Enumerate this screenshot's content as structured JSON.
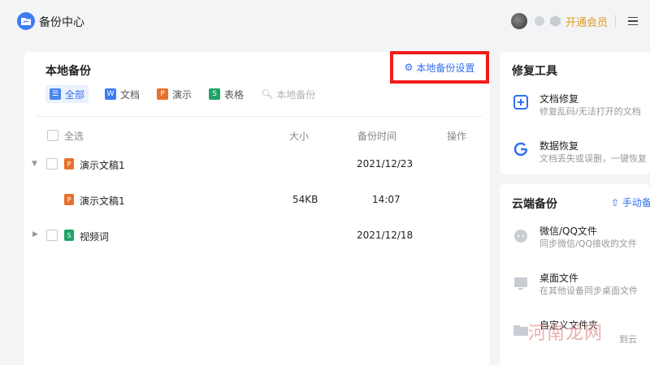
{
  "app": {
    "title": "备份中心"
  },
  "header": {
    "vip_label": "开通会员",
    "icons": [
      "logo-icon",
      "avatar",
      "member-badge-icon",
      "shield-badge-icon",
      "menu-icon"
    ]
  },
  "local_backup": {
    "title": "本地备份",
    "settings_label": "本地备份设置",
    "tabs": [
      {
        "label": "全部",
        "icon": "list-icon",
        "icon_text": "☰",
        "color": "#4a86f0",
        "active": true
      },
      {
        "label": "文档",
        "icon": "word-icon",
        "icon_text": "W",
        "color": "#3d7cf5",
        "active": false
      },
      {
        "label": "演示",
        "icon": "ppt-icon",
        "icon_text": "P",
        "color": "#e8702a",
        "active": false
      },
      {
        "label": "表格",
        "icon": "sheet-icon",
        "icon_text": "S",
        "color": "#21a366",
        "active": false
      }
    ],
    "search_label": "本地备份",
    "columns": {
      "select_all": "全选",
      "size": "大小",
      "time": "备份时间",
      "action": "操作"
    },
    "rows": [
      {
        "name": "演示文稿1",
        "size": "",
        "time": "2021/12/23",
        "expanded": true,
        "type": "ppt"
      },
      {
        "name": "演示文稿1",
        "size": "54KB",
        "time": "14:07",
        "child": true,
        "type": "ppt"
      },
      {
        "name": "视频词",
        "size": "",
        "time": "2021/12/18",
        "expanded": false,
        "type": "sheet"
      }
    ]
  },
  "repair_tools": {
    "title": "修复工具",
    "items": [
      {
        "title": "文档修复",
        "subtitle": "修复乱码/无法打开的文档",
        "icon": "doc-repair-icon"
      },
      {
        "title": "数据恢复",
        "subtitle": "文档丢失或误删，一键恢复",
        "icon": "data-recovery-icon"
      }
    ]
  },
  "cloud_backup": {
    "title": "云端备份",
    "manual_label": "手动备",
    "items": [
      {
        "title": "微信/QQ文件",
        "subtitle": "同步微信/QQ接收的文件",
        "icon": "chat-cloud-icon"
      },
      {
        "title": "桌面文件",
        "subtitle": "在其他设备同步桌面文件",
        "icon": "desktop-icon"
      },
      {
        "title": "自定义文件夹",
        "subtitle": "到云",
        "icon": "folder-icon"
      }
    ]
  },
  "watermark": "河南龙网",
  "colors": {
    "accent": "#2f6fef",
    "highlight_border": "#f01c1c",
    "vip": "#e39a1c"
  }
}
